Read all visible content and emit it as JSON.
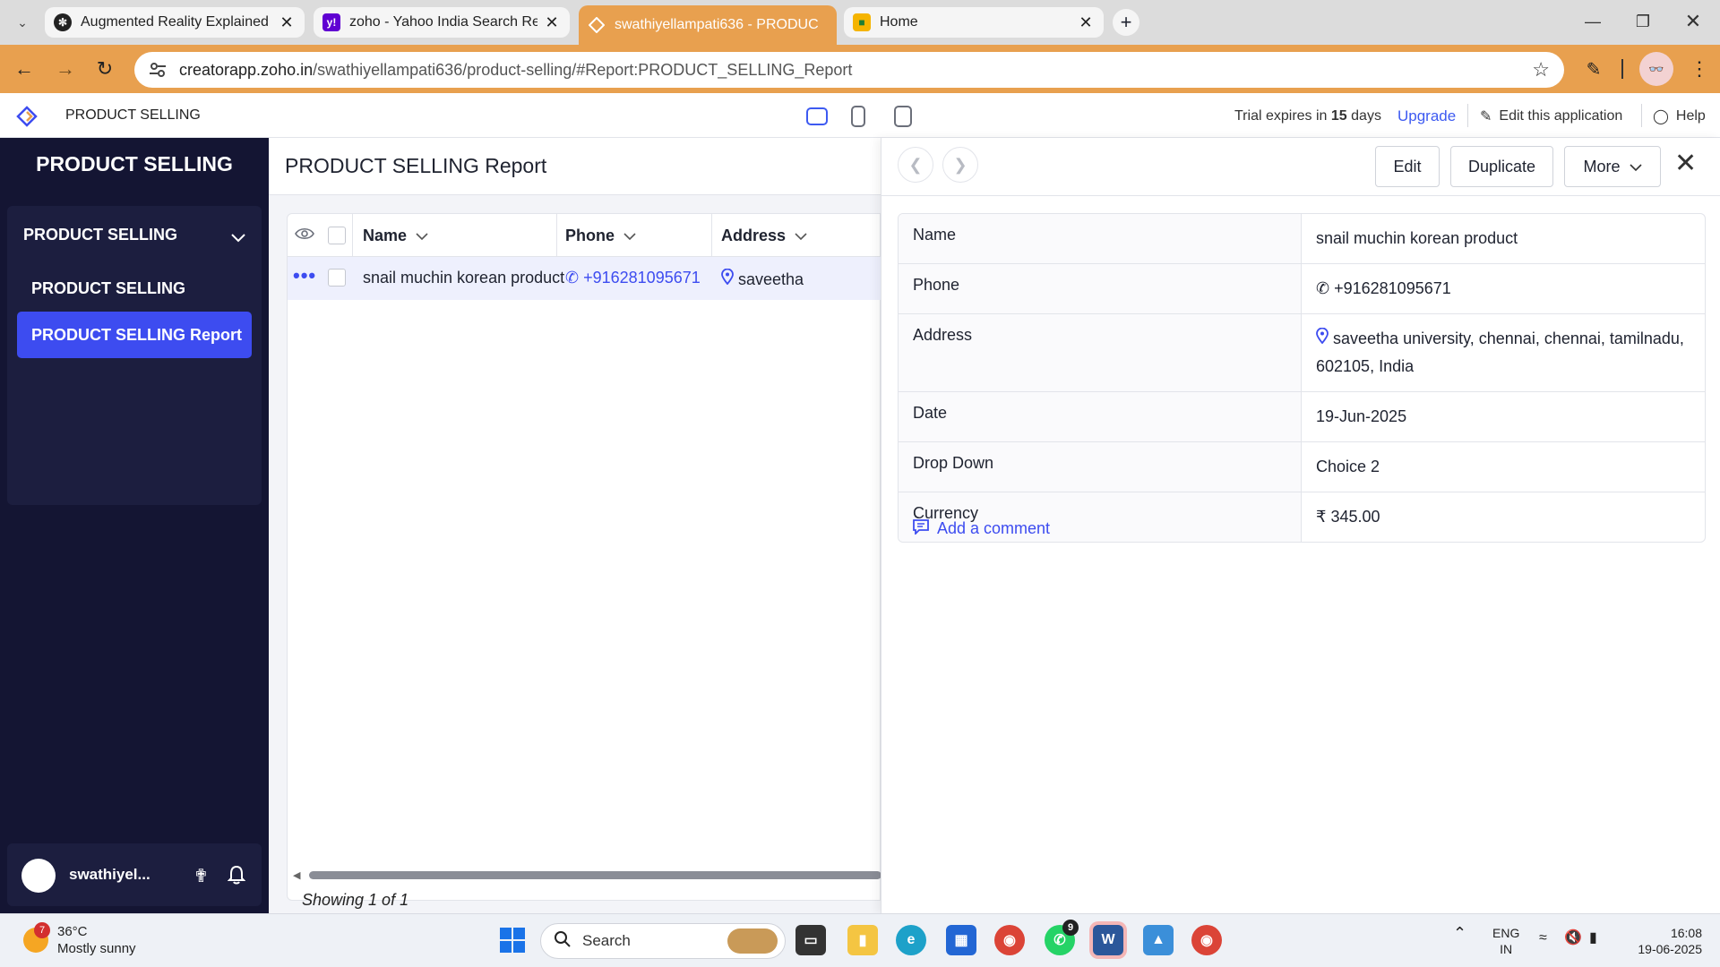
{
  "browser": {
    "tabs": [
      {
        "title": "Augmented Reality Explained",
        "icon": "openai-icon"
      },
      {
        "title": "zoho - Yahoo India Search Resu",
        "icon": "yahoo-icon"
      },
      {
        "title": "swathiyellampati636 -  PRODUC",
        "icon": "zoho-creator-icon",
        "active": true
      },
      {
        "title": "Home",
        "icon": "classroom-icon"
      }
    ],
    "url_host": "creatorapp.zoho.in",
    "url_path": "/swathiyellampati636/product-selling/#Report:PRODUCT_SELLING_Report"
  },
  "app_header": {
    "title": "PRODUCT SELLING",
    "trial_prefix": "Trial expires in",
    "trial_days": "15",
    "trial_suffix": "days",
    "upgrade": "Upgrade",
    "edit_app": "Edit this application",
    "help": "Help"
  },
  "sidebar": {
    "title": "PRODUCT SELLING",
    "section": "PRODUCT SELLING",
    "items": [
      {
        "label": "PRODUCT SELLING"
      },
      {
        "label": "PRODUCT SELLING Report",
        "active": true
      }
    ],
    "user": "swathiyel..."
  },
  "report": {
    "title": "PRODUCT SELLING Report",
    "columns": [
      "Name",
      "Phone",
      "Address"
    ],
    "rows": [
      {
        "name": "snail muchin korean product",
        "phone": "+916281095671",
        "address": "saveetha"
      }
    ],
    "footer": "Showing 1 of 1"
  },
  "detail": {
    "buttons": {
      "edit": "Edit",
      "duplicate": "Duplicate",
      "more": "More"
    },
    "fields": [
      {
        "label": "Name",
        "value": "snail muchin korean product"
      },
      {
        "label": "Phone",
        "value": "+916281095671"
      },
      {
        "label": "Address",
        "value": "saveetha university, chennai, chennai, tamilnadu, 602105, India"
      },
      {
        "label": "Date",
        "value": "19-Jun-2025"
      },
      {
        "label": "Drop Down",
        "value": "Choice 2"
      },
      {
        "label": "Currency",
        "value": "₹ 345.00"
      }
    ],
    "add_comment": "Add a comment"
  },
  "taskbar": {
    "temperature": "36°C",
    "weather": "Mostly sunny",
    "weather_badge": "7",
    "search": "Search",
    "whatsapp_badge": "9",
    "lang1": "ENG",
    "lang2": "IN",
    "time": "16:08",
    "date": "19-06-2025"
  },
  "colors": {
    "accent": "#3d4cf0",
    "sidebar": "#141533",
    "browser_theme": "#e8a04f"
  }
}
